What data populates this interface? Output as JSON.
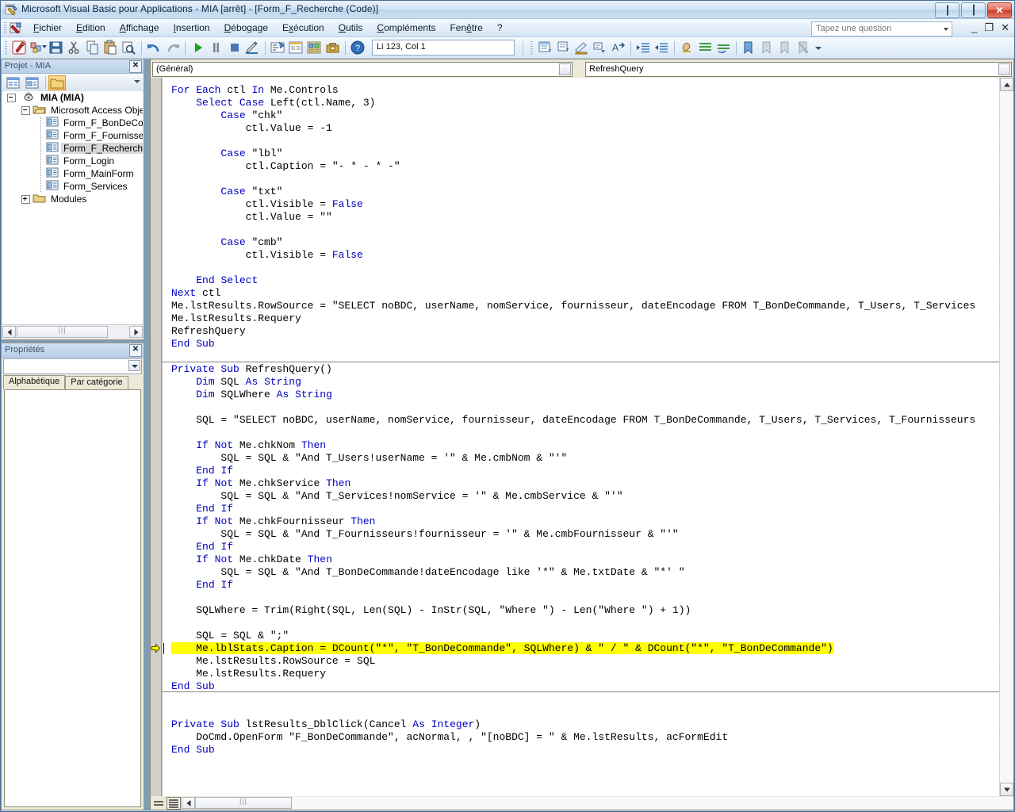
{
  "window": {
    "title": "Microsoft Visual Basic pour Applications - MIA [arrêt] - [Form_F_Recherche (Code)]",
    "app_icon": "vba-icon",
    "minimize_label": "Réduire",
    "maximize_label": "Agrandir",
    "close_label": "Fermer"
  },
  "menubar": {
    "items": [
      {
        "label": "Fichier",
        "accel": "F"
      },
      {
        "label": "Edition",
        "accel": "E"
      },
      {
        "label": "Affichage",
        "accel": "A"
      },
      {
        "label": "Insertion",
        "accel": "I"
      },
      {
        "label": "Débogage",
        "accel": "D"
      },
      {
        "label": "Exécution",
        "accel": "x"
      },
      {
        "label": "Outils",
        "accel": "O"
      },
      {
        "label": "Compléments",
        "accel": "C"
      },
      {
        "label": "Fenêtre",
        "accel": "ê"
      },
      {
        "label": "?",
        "accel": ""
      }
    ],
    "ask_box_placeholder": "Tapez une question",
    "mdi_minimize": "_",
    "mdi_restore": "❐",
    "mdi_close": "✕"
  },
  "toolbar": {
    "position_indicator": "Li 123, Col 1",
    "buttons": [
      {
        "name": "view-access-icon",
        "title": "Afficher Microsoft Access"
      },
      {
        "name": "insert-object-icon",
        "title": "Insérer"
      },
      {
        "name": "save-icon",
        "title": "Enregistrer"
      },
      {
        "name": "cut-icon",
        "title": "Couper"
      },
      {
        "name": "copy-icon",
        "title": "Copier"
      },
      {
        "name": "paste-icon",
        "title": "Coller"
      },
      {
        "name": "find-icon",
        "title": "Rechercher"
      },
      {
        "name": "undo-icon",
        "title": "Annuler"
      },
      {
        "name": "redo-icon",
        "title": "Rétablir"
      },
      {
        "name": "run-icon",
        "title": "Exécuter Sub/UserForm"
      },
      {
        "name": "pause-icon",
        "title": "Interrompre"
      },
      {
        "name": "stop-icon",
        "title": "Réinitialiser"
      },
      {
        "name": "design-mode-icon",
        "title": "Mode création"
      },
      {
        "name": "project-explorer-icon",
        "title": "Explorateur de projet"
      },
      {
        "name": "properties-window-icon",
        "title": "Fenêtre Propriétés"
      },
      {
        "name": "object-browser-icon",
        "title": "Explorateur d'objets"
      },
      {
        "name": "toolbox-icon",
        "title": "Boîte à outils"
      },
      {
        "name": "help-icon",
        "title": "Aide"
      }
    ],
    "edit_buttons": [
      {
        "name": "list-properties-icon",
        "title": "Liste des propriétés/méthodes"
      },
      {
        "name": "list-constants-icon",
        "title": "Liste des constantes"
      },
      {
        "name": "quick-info-icon",
        "title": "Info express"
      },
      {
        "name": "parameter-info-icon",
        "title": "Info paramètres"
      },
      {
        "name": "complete-word-icon",
        "title": "Compléter le mot"
      },
      {
        "name": "indent-icon",
        "title": "Retrait"
      },
      {
        "name": "outdent-icon",
        "title": "Retrait négatif"
      },
      {
        "name": "toggle-breakpoint-icon",
        "title": "Point d'arrêt"
      },
      {
        "name": "comment-block-icon",
        "title": "Bloc commentaire"
      },
      {
        "name": "uncomment-block-icon",
        "title": "Bloc non commentaire"
      },
      {
        "name": "toggle-bookmark-icon",
        "title": "Activer/désactiver signet"
      },
      {
        "name": "next-bookmark-icon",
        "title": "Signet suivant"
      },
      {
        "name": "prev-bookmark-icon",
        "title": "Signet précédent"
      },
      {
        "name": "clear-bookmarks-icon",
        "title": "Effacer tous les signets"
      }
    ]
  },
  "project_explorer": {
    "title": "Projet - MIA",
    "close_label": "✕",
    "toolbar_buttons": [
      {
        "name": "view-code-icon",
        "title": "Code"
      },
      {
        "name": "view-object-icon",
        "title": "Objet"
      },
      {
        "name": "toggle-folders-icon",
        "title": "Dossiers"
      }
    ],
    "tree": [
      {
        "label": "MIA (MIA)",
        "level": 0,
        "expander": "minus",
        "icon": "project-icon",
        "bold": true
      },
      {
        "label": "Microsoft Access Objets",
        "level": 1,
        "expander": "minus",
        "icon": "folder-open-icon"
      },
      {
        "label": "Form_F_BonDeComm",
        "level": 2,
        "expander": "none",
        "icon": "form-module-icon"
      },
      {
        "label": "Form_F_Fournisseur",
        "level": 2,
        "expander": "none",
        "icon": "form-module-icon"
      },
      {
        "label": "Form_F_Recherche",
        "level": 2,
        "expander": "none",
        "icon": "form-module-icon",
        "selected": true
      },
      {
        "label": "Form_Login",
        "level": 2,
        "expander": "none",
        "icon": "form-module-icon"
      },
      {
        "label": "Form_MainForm",
        "level": 2,
        "expander": "none",
        "icon": "form-module-icon"
      },
      {
        "label": "Form_Services",
        "level": 2,
        "expander": "none",
        "icon": "form-module-icon"
      },
      {
        "label": "Modules",
        "level": 1,
        "expander": "plus",
        "icon": "folder-icon"
      }
    ]
  },
  "properties_panel": {
    "title": "Propriétés",
    "close_label": "✕",
    "object_value": "",
    "tabs": [
      {
        "label": "Alphabétique",
        "active": true
      },
      {
        "label": "Par catégorie",
        "active": false
      }
    ]
  },
  "code_window": {
    "object_dropdown": "(Général)",
    "procedure_dropdown": "RefreshQuery",
    "view_buttons": [
      {
        "name": "procedure-view-button",
        "title": "Affichage de procédure"
      },
      {
        "name": "full-module-view-button",
        "title": "Affichage du module entier",
        "active": true
      }
    ],
    "execution_line_index": 44,
    "separator_after_line_index": 21,
    "lines": [
      {
        "t": "For Each ctl In Me.Controls",
        "kw": [
          "For",
          "Each",
          "In"
        ]
      },
      {
        "t": "    Select Case Left(ctl.Name, 3)",
        "kw": [
          "Select",
          "Case"
        ]
      },
      {
        "t": "        Case \"chk\"",
        "kw": [
          "Case"
        ]
      },
      {
        "t": "            ctl.Value = -1",
        "kw": []
      },
      {
        "t": "",
        "kw": []
      },
      {
        "t": "        Case \"lbl\"",
        "kw": [
          "Case"
        ]
      },
      {
        "t": "            ctl.Caption = \"- * - * -\"",
        "kw": []
      },
      {
        "t": "",
        "kw": []
      },
      {
        "t": "        Case \"txt\"",
        "kw": [
          "Case"
        ]
      },
      {
        "t": "            ctl.Visible = False",
        "kw": [
          "False"
        ]
      },
      {
        "t": "            ctl.Value = \"\"",
        "kw": []
      },
      {
        "t": "",
        "kw": []
      },
      {
        "t": "        Case \"cmb\"",
        "kw": [
          "Case"
        ]
      },
      {
        "t": "            ctl.Visible = False",
        "kw": [
          "False"
        ]
      },
      {
        "t": "",
        "kw": []
      },
      {
        "t": "    End Select",
        "kw": [
          "End",
          "Select"
        ]
      },
      {
        "t": "Next ctl",
        "kw": [
          "Next"
        ]
      },
      {
        "t": "Me.lstResults.RowSource = \"SELECT noBDC, userName, nomService, fournisseur, dateEncodage FROM T_BonDeCommande, T_Users, T_Services",
        "kw": []
      },
      {
        "t": "Me.lstResults.Requery",
        "kw": []
      },
      {
        "t": "RefreshQuery",
        "kw": []
      },
      {
        "t": "End Sub",
        "kw": [
          "End",
          "Sub"
        ]
      },
      {
        "t": "",
        "kw": []
      },
      {
        "t": "Private Sub RefreshQuery()",
        "kw": [
          "Private",
          "Sub"
        ]
      },
      {
        "t": "    Dim SQL As String",
        "kw": [
          "Dim",
          "As",
          "String"
        ]
      },
      {
        "t": "    Dim SQLWhere As String",
        "kw": [
          "Dim",
          "As",
          "String"
        ]
      },
      {
        "t": "",
        "kw": []
      },
      {
        "t": "    SQL = \"SELECT noBDC, userName, nomService, fournisseur, dateEncodage FROM T_BonDeCommande, T_Users, T_Services, T_Fournisseurs",
        "kw": []
      },
      {
        "t": "",
        "kw": []
      },
      {
        "t": "    If Not Me.chkNom Then",
        "kw": [
          "If",
          "Not",
          "Then"
        ]
      },
      {
        "t": "        SQL = SQL & \"And T_Users!userName = '\" & Me.cmbNom & \"'\"",
        "kw": []
      },
      {
        "t": "    End If",
        "kw": [
          "End",
          "If"
        ]
      },
      {
        "t": "    If Not Me.chkService Then",
        "kw": [
          "If",
          "Not",
          "Then"
        ]
      },
      {
        "t": "        SQL = SQL & \"And T_Services!nomService = '\" & Me.cmbService & \"'\"",
        "kw": []
      },
      {
        "t": "    End If",
        "kw": [
          "End",
          "If"
        ]
      },
      {
        "t": "    If Not Me.chkFournisseur Then",
        "kw": [
          "If",
          "Not",
          "Then"
        ]
      },
      {
        "t": "        SQL = SQL & \"And T_Fournisseurs!fournisseur = '\" & Me.cmbFournisseur & \"'\"",
        "kw": []
      },
      {
        "t": "    End If",
        "kw": [
          "End",
          "If"
        ]
      },
      {
        "t": "    If Not Me.chkDate Then",
        "kw": [
          "If",
          "Not",
          "Then"
        ]
      },
      {
        "t": "        SQL = SQL & \"And T_BonDeCommande!dateEncodage like '*\" & Me.txtDate & \"*' \"",
        "kw": []
      },
      {
        "t": "    End If",
        "kw": [
          "End",
          "If"
        ]
      },
      {
        "t": "",
        "kw": []
      },
      {
        "t": "    SQLWhere = Trim(Right(SQL, Len(SQL) - InStr(SQL, \"Where \") - Len(\"Where \") + 1))",
        "kw": []
      },
      {
        "t": "",
        "kw": []
      },
      {
        "t": "    SQL = SQL & \";\"",
        "kw": []
      },
      {
        "t": "    Me.lblStats.Caption = DCount(\"*\", \"T_BonDeCommande\", SQLWhere) & \" / \" & DCount(\"*\", \"T_BonDeCommande\")",
        "kw": [],
        "highlight": true
      },
      {
        "t": "    Me.lstResults.RowSource = SQL",
        "kw": []
      },
      {
        "t": "    Me.lstResults.Requery",
        "kw": []
      },
      {
        "t": "End Sub",
        "kw": [
          "End",
          "Sub"
        ]
      },
      {
        "t": "",
        "kw": []
      },
      {
        "t": "",
        "kw": []
      },
      {
        "t": "Private Sub lstResults_DblClick(Cancel As Integer)",
        "kw": [
          "Private",
          "Sub",
          "As",
          "Integer"
        ]
      },
      {
        "t": "    DoCmd.OpenForm \"F_BonDeCommande\", acNormal, , \"[noBDC] = \" & Me.lstResults, acFormEdit",
        "kw": []
      },
      {
        "t": "End Sub",
        "kw": [
          "End",
          "Sub"
        ]
      }
    ]
  },
  "colors": {
    "keyword": "#0000C0",
    "code_text": "#000000",
    "highlight": "#FFFF00",
    "titlebar_text": "#10243B",
    "panel_title_text": "#39506B"
  }
}
